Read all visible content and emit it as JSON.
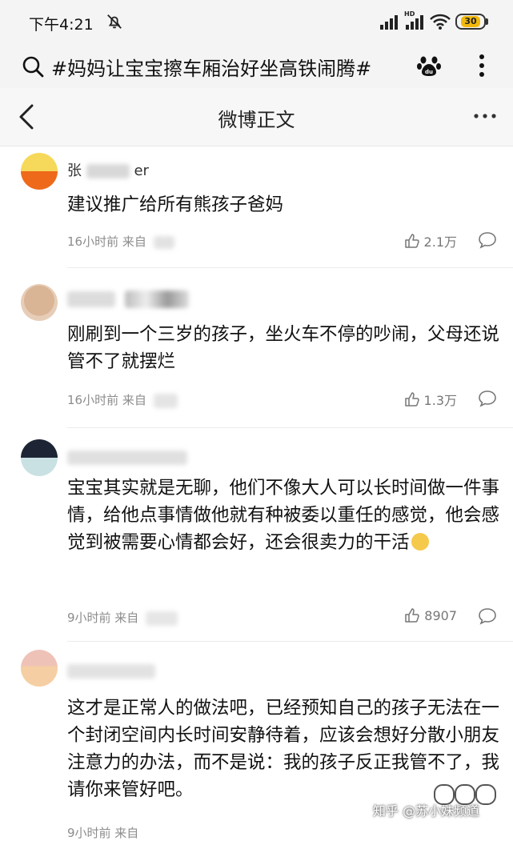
{
  "status_bar": {
    "time": "下午4:21",
    "battery": "30",
    "network_label": "HD"
  },
  "search": {
    "query": "#妈妈让宝宝擦车厢治好坐高铁闹腾#"
  },
  "nav": {
    "title": "微博正文"
  },
  "comments": [
    {
      "username": "张",
      "username_tail": "er",
      "text": "建议推广给所有熊孩子爸妈",
      "time": "16小时前 来自",
      "likes": "2.1万",
      "avatar_colors": [
        "#f6d95a",
        "#ee6a1a"
      ]
    },
    {
      "username": "",
      "text": "刚刷到一个三岁的孩子，坐火车不停的吵闹，父母还说管不了就摆烂",
      "time": "16小时前 来自",
      "likes": "1.3万",
      "avatar_colors": [
        "#d9b596",
        "#e7cdb7"
      ]
    },
    {
      "username": "",
      "text": "宝宝其实就是无聊，他们不像大人可以长时间做一件事情，给他点事情做他就有种被委以重任的感觉，他会感觉到被需要心情都会好，还会很卖力的干活",
      "time": "9小时前 来自",
      "likes": "8907",
      "avatar_colors": [
        "#1d2535",
        "#c9e1e3"
      ]
    },
    {
      "username": "",
      "text": "这才是正常人的做法吧，已经预知自己的孩子无法在一个封闭空间内长时间安静待着，应该会想好分散小朋友注意力的办法，而不是说：我的孩子反正我管不了，我请你来管好吧。",
      "time": "9小时前 来自",
      "likes": "",
      "avatar_colors": [
        "#efc2b8",
        "#f5cfa3"
      ]
    }
  ],
  "watermark": "知乎 @苏小妹频道",
  "icons": {
    "silent": "bell-off-icon",
    "search": "search-icon",
    "paw": "baidu-paw-icon",
    "more": "more-vertical-icon",
    "back": "chevron-left-icon",
    "nav_more": "more-horizontal-icon",
    "like": "thumbs-up-icon",
    "reply": "comment-bubble-icon"
  },
  "colors": {
    "battery_fill": "#f2b90c",
    "link": "#111111",
    "meta": "#8c8c8c"
  }
}
